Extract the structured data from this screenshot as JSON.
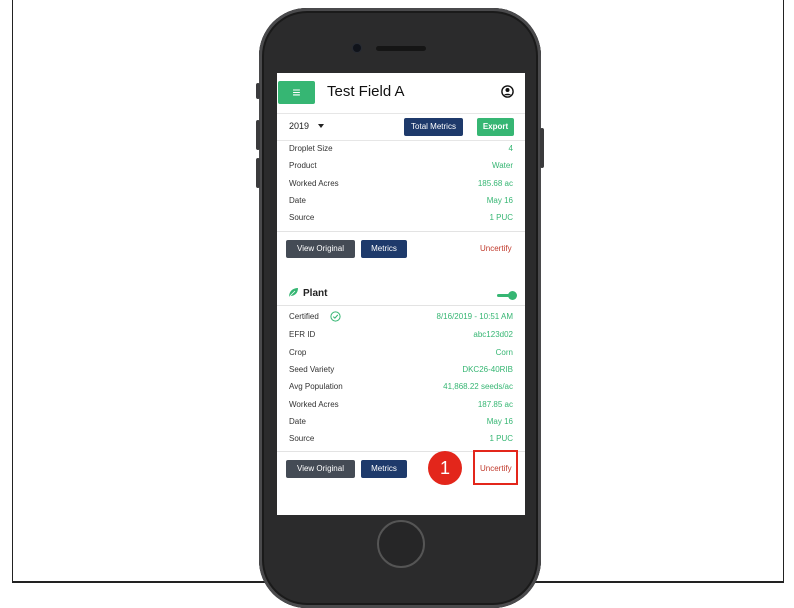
{
  "app": {
    "title": "Test Field A",
    "menu_icon": "≡",
    "user_icon": "user-circle-icon"
  },
  "controls": {
    "year": "2019",
    "total_metrics_label": "Total Metrics",
    "export_label": "Export"
  },
  "spray_record": {
    "rows": [
      {
        "label": "Droplet Size",
        "value": "4"
      },
      {
        "label": "Product",
        "value": "Water"
      },
      {
        "label": "Worked Acres",
        "value": "185.68 ac"
      },
      {
        "label": "Date",
        "value": "May 16"
      },
      {
        "label": "Source",
        "value": "1 PUC"
      }
    ],
    "view_original_label": "View Original",
    "metrics_label": "Metrics",
    "uncertify_label": "Uncertify"
  },
  "plant_record": {
    "title": "Plant",
    "toggle_on": true,
    "rows": [
      {
        "label": "Certified",
        "value": "8/16/2019 - 10:51 AM"
      },
      {
        "label": "EFR ID",
        "value": "abc123d02"
      },
      {
        "label": "Crop",
        "value": "Corn"
      },
      {
        "label": "Seed Variety",
        "value": "DKC26-40RIB"
      },
      {
        "label": "Avg Population",
        "value": "41,868.22 seeds/ac"
      },
      {
        "label": "Worked Acres",
        "value": "187.85 ac"
      },
      {
        "label": "Date",
        "value": "May 16"
      },
      {
        "label": "Source",
        "value": "1 PUC"
      }
    ],
    "view_original_label": "View Original",
    "metrics_label": "Metrics",
    "uncertify_label": "Uncertify"
  },
  "annotation": {
    "step_number": "1"
  },
  "colors": {
    "accent_green": "#36b673",
    "navy": "#1e3a6b",
    "danger_red": "#c0392b",
    "highlight_red": "#e3261b"
  }
}
